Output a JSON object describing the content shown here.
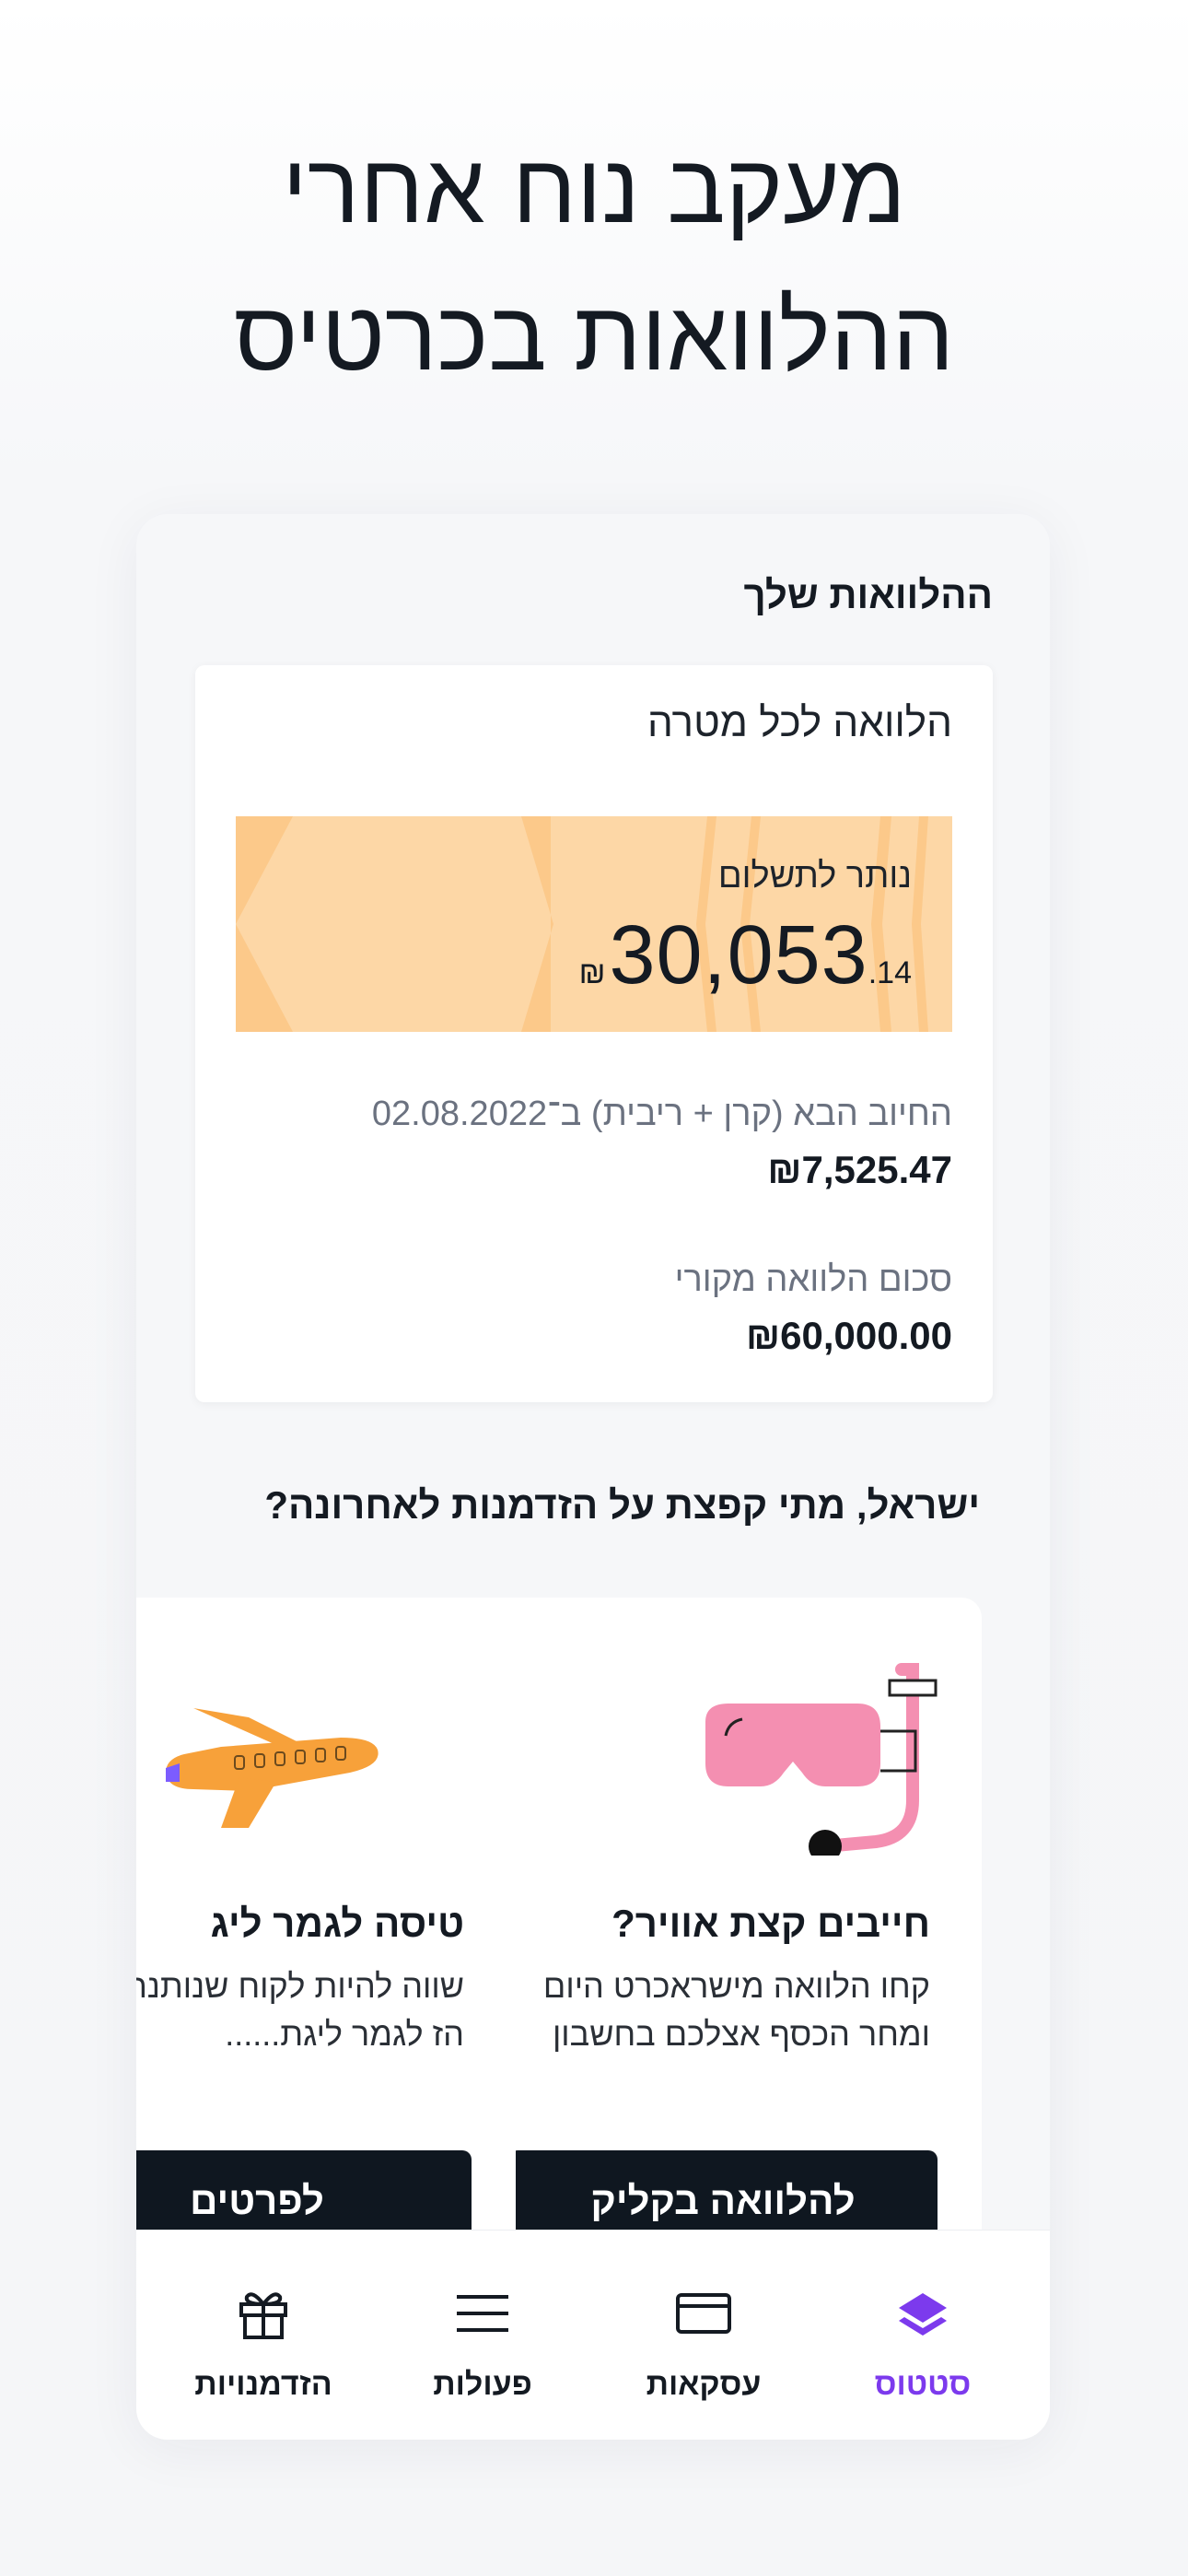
{
  "headline": {
    "line1": "מעקב נוח אחרי",
    "line2": "ההלוואות בכרטיס"
  },
  "loans": {
    "section_title": "ההלוואות שלך",
    "card": {
      "name": "הלוואה לכל מטרה",
      "remaining_label": "נותר לתשלום",
      "remaining_currency": "₪",
      "remaining_integer": "30,053",
      "remaining_decimal": ".14",
      "next_charge_label": "החיוב הבא (קרן + ריבית) ב־02.08.2022",
      "next_charge_value": "₪7,525.47",
      "original_amount_label": "סכום הלוואה מקורי",
      "original_amount_value": "₪60,000.00"
    }
  },
  "opportunities": {
    "title": "ישראל, מתי קפצת על הזדמנות לאחרונה?",
    "cards": [
      {
        "icon": "snorkel-mask-icon",
        "title": "חייבים קצת אוויר?",
        "body": "קחו הלוואה מישראכרט היום ומחר הכסף אצלכם בחשבון",
        "button": "להלוואה בקליק"
      },
      {
        "icon": "airplane-icon",
        "title": "טיסה לגמר ליג",
        "body": "שווה להיות לקוח שנותנת לכם הז לגמר ליגת......",
        "button": "לפרטים"
      }
    ]
  },
  "tabbar": {
    "items": [
      {
        "label": "סטטוס",
        "icon": "layers-icon",
        "active": true
      },
      {
        "label": "עסקאות",
        "icon": "card-icon",
        "active": false
      },
      {
        "label": "פעולות",
        "icon": "menu-icon",
        "active": false
      },
      {
        "label": "הזדמנויות",
        "icon": "gift-icon",
        "active": false
      }
    ]
  },
  "colors": {
    "accent": "#7C3AED",
    "banner": "#FDD7A6",
    "button": "#0F1720"
  }
}
